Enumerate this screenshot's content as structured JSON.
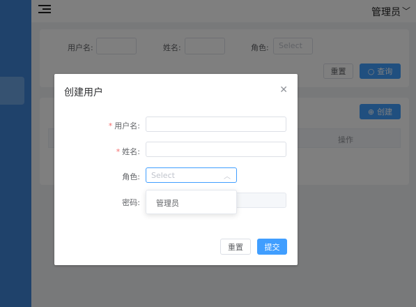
{
  "header": {
    "user": "管理员"
  },
  "search": {
    "username_label": "用户名:",
    "name_label": "姓名:",
    "role_label": "角色:",
    "role_placeholder": "Select",
    "reset": "重置",
    "query": "查询"
  },
  "table": {
    "create": "创建",
    "col_action": "操作"
  },
  "dialog": {
    "title": "创建用户",
    "username_label": "用户名:",
    "name_label": "姓名:",
    "role_label": "角色:",
    "role_placeholder": "Select",
    "password_label": "密码:",
    "role_options": [
      "管理员"
    ],
    "reset": "重置",
    "submit": "提交"
  }
}
